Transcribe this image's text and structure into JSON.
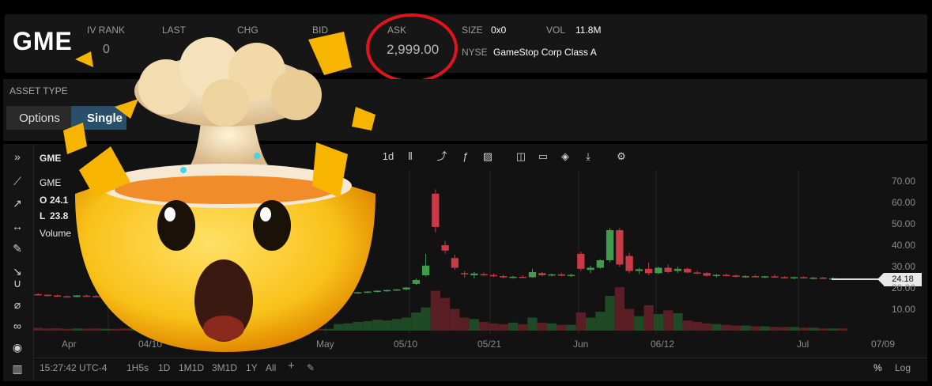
{
  "header": {
    "ticker": "GME",
    "iv_rank_label": "IV RANK",
    "iv_rank_value": "0",
    "last_label": "LAST",
    "chg_label": "CHG",
    "bid_label": "BID",
    "ask_label": "ASK",
    "ask_value": "2,999.00",
    "size_label": "SIZE",
    "size_value": "0x0",
    "vol_label": "VOL",
    "vol_value": "11.8M",
    "exchange": "NYSE",
    "company": "GameStop Corp Class A"
  },
  "asset": {
    "label": "ASSET TYPE",
    "options_label": "Options",
    "single_label": "Single"
  },
  "chart": {
    "symbol_label": "GME",
    "legend_symbol": "GME",
    "open_label": "O",
    "open_value": "24.1",
    "low_label": "L",
    "low_value": "23.8",
    "volume_label": "Volume",
    "interval": "1d",
    "last_price": "24.18",
    "x_labels": [
      "Apr",
      "04/10",
      "May",
      "05/10",
      "05/21",
      "Jun",
      "06/12",
      "Jul",
      "07/09"
    ],
    "y_labels": [
      "70.00",
      "60.00",
      "50.00",
      "40.00",
      "30.00",
      "20.00",
      "10.00"
    ]
  },
  "bottom": {
    "time": "15:27:42 UTC-4",
    "ranges": [
      "1H5s",
      "1D",
      "1M1D",
      "3M1D",
      "1Y",
      "All"
    ],
    "percent": "%",
    "log": "Log"
  },
  "colors": {
    "up": "#3e9c4c",
    "down": "#c93a46",
    "ask_circle": "#e0141c",
    "single_bg": "#2a4f6b"
  },
  "chart_data": {
    "type": "candlestick",
    "x_axis_labels": [
      "Apr",
      "04/10",
      "May",
      "05/10",
      "05/21",
      "Jun",
      "06/12",
      "Jul",
      "07/09"
    ],
    "y_axis_labels": [
      "70.00",
      "60.00",
      "50.00",
      "40.00",
      "30.00",
      "20.00",
      "10.00"
    ],
    "ylim": [
      5,
      75
    ],
    "last": 24.18,
    "candles": [
      {
        "o": 17.2,
        "h": 17.6,
        "l": 16.8,
        "c": 16.9
      },
      {
        "o": 16.9,
        "h": 17.1,
        "l": 16.2,
        "c": 16.5
      },
      {
        "o": 16.6,
        "h": 17.0,
        "l": 16.1,
        "c": 16.3
      },
      {
        "o": 16.2,
        "h": 16.6,
        "l": 15.8,
        "c": 16.0
      },
      {
        "o": 15.9,
        "h": 16.8,
        "l": 15.6,
        "c": 16.6
      },
      {
        "o": 16.5,
        "h": 17.0,
        "l": 16.1,
        "c": 16.4
      },
      {
        "o": 16.3,
        "h": 16.7,
        "l": 15.9,
        "c": 16.1
      },
      {
        "o": 16.1,
        "h": 16.6,
        "l": 15.7,
        "c": 16.4
      },
      {
        "o": 16.4,
        "h": 16.9,
        "l": 16.0,
        "c": 16.2
      },
      {
        "o": 16.2,
        "h": 16.5,
        "l": 15.8,
        "c": 15.9
      },
      {
        "o": 16.0,
        "h": 16.4,
        "l": 15.6,
        "c": 16.2
      },
      {
        "o": 16.2,
        "h": 16.6,
        "l": 15.9,
        "c": 16.0
      },
      {
        "o": 16.0,
        "h": 16.3,
        "l": 15.5,
        "c": 15.7
      },
      {
        "o": 15.8,
        "h": 16.2,
        "l": 15.4,
        "c": 16.0
      },
      {
        "o": 16.0,
        "h": 16.4,
        "l": 15.6,
        "c": 15.8
      },
      {
        "o": 15.8,
        "h": 16.0,
        "l": 15.2,
        "c": 15.4
      },
      {
        "o": 15.4,
        "h": 15.9,
        "l": 15.0,
        "c": 15.7
      },
      {
        "o": 15.7,
        "h": 16.1,
        "l": 15.3,
        "c": 15.5
      },
      {
        "o": 15.5,
        "h": 15.9,
        "l": 15.1,
        "c": 15.8
      },
      {
        "o": 15.8,
        "h": 16.2,
        "l": 15.4,
        "c": 15.6
      },
      {
        "o": 15.6,
        "h": 16.0,
        "l": 15.3,
        "c": 15.9
      },
      {
        "o": 15.9,
        "h": 16.3,
        "l": 15.5,
        "c": 15.7
      },
      {
        "o": 15.7,
        "h": 16.0,
        "l": 15.2,
        "c": 15.4
      },
      {
        "o": 15.4,
        "h": 15.8,
        "l": 15.0,
        "c": 15.6
      },
      {
        "o": 15.6,
        "h": 15.9,
        "l": 15.2,
        "c": 15.3
      },
      {
        "o": 15.3,
        "h": 15.7,
        "l": 14.9,
        "c": 15.5
      },
      {
        "o": 15.5,
        "h": 15.9,
        "l": 15.1,
        "c": 15.2
      },
      {
        "o": 15.2,
        "h": 15.6,
        "l": 14.8,
        "c": 15.4
      },
      {
        "o": 15.4,
        "h": 15.8,
        "l": 15.0,
        "c": 15.6
      },
      {
        "o": 15.6,
        "h": 16.0,
        "l": 15.2,
        "c": 15.3
      },
      {
        "o": 15.3,
        "h": 15.8,
        "l": 15.0,
        "c": 15.7
      },
      {
        "o": 17.0,
        "h": 17.8,
        "l": 16.6,
        "c": 17.5
      },
      {
        "o": 17.4,
        "h": 18.0,
        "l": 17.0,
        "c": 17.8
      },
      {
        "o": 17.8,
        "h": 18.3,
        "l": 17.4,
        "c": 18.1
      },
      {
        "o": 18.1,
        "h": 18.6,
        "l": 17.7,
        "c": 18.4
      },
      {
        "o": 18.4,
        "h": 19.0,
        "l": 18.0,
        "c": 18.8
      },
      {
        "o": 18.8,
        "h": 19.4,
        "l": 18.3,
        "c": 19.1
      },
      {
        "o": 19.1,
        "h": 19.6,
        "l": 18.7,
        "c": 19.4
      },
      {
        "o": 19.4,
        "h": 20.5,
        "l": 19.0,
        "c": 20.3
      },
      {
        "o": 22.0,
        "h": 24.5,
        "l": 21.5,
        "c": 23.8
      },
      {
        "o": 26.0,
        "h": 36.0,
        "l": 25.5,
        "c": 30.5
      },
      {
        "o": 64.0,
        "h": 66.0,
        "l": 46.0,
        "c": 48.5
      },
      {
        "o": 40.0,
        "h": 42.0,
        "l": 36.0,
        "c": 37.5
      },
      {
        "o": 34.0,
        "h": 35.5,
        "l": 28.5,
        "c": 29.5
      },
      {
        "o": 27.0,
        "h": 28.0,
        "l": 25.0,
        "c": 26.5
      },
      {
        "o": 26.0,
        "h": 27.5,
        "l": 24.5,
        "c": 26.8
      },
      {
        "o": 26.5,
        "h": 27.3,
        "l": 25.8,
        "c": 26.1
      },
      {
        "o": 26.1,
        "h": 26.8,
        "l": 25.2,
        "c": 25.6
      },
      {
        "o": 25.6,
        "h": 26.3,
        "l": 24.6,
        "c": 25.0
      },
      {
        "o": 25.0,
        "h": 25.8,
        "l": 24.4,
        "c": 25.3
      },
      {
        "o": 25.3,
        "h": 26.0,
        "l": 24.8,
        "c": 25.1
      },
      {
        "o": 25.1,
        "h": 29.0,
        "l": 24.8,
        "c": 27.5
      },
      {
        "o": 27.0,
        "h": 27.5,
        "l": 25.6,
        "c": 26.0
      },
      {
        "o": 26.0,
        "h": 26.8,
        "l": 25.5,
        "c": 26.4
      },
      {
        "o": 26.4,
        "h": 27.1,
        "l": 25.5,
        "c": 25.8
      },
      {
        "o": 25.8,
        "h": 26.6,
        "l": 25.2,
        "c": 26.2
      },
      {
        "o": 36.0,
        "h": 37.0,
        "l": 28.0,
        "c": 29.0
      },
      {
        "o": 28.5,
        "h": 30.5,
        "l": 27.0,
        "c": 29.5
      },
      {
        "o": 29.5,
        "h": 33.5,
        "l": 29.0,
        "c": 33.0
      },
      {
        "o": 33.0,
        "h": 48.0,
        "l": 32.0,
        "c": 47.0
      },
      {
        "o": 47.0,
        "h": 48.0,
        "l": 30.0,
        "c": 31.0
      },
      {
        "o": 35.0,
        "h": 36.5,
        "l": 27.0,
        "c": 28.0
      },
      {
        "o": 28.0,
        "h": 29.5,
        "l": 26.5,
        "c": 28.8
      },
      {
        "o": 29.0,
        "h": 32.0,
        "l": 26.0,
        "c": 27.0
      },
      {
        "o": 27.0,
        "h": 30.0,
        "l": 26.5,
        "c": 29.5
      },
      {
        "o": 29.5,
        "h": 31.0,
        "l": 27.0,
        "c": 27.5
      },
      {
        "o": 28.0,
        "h": 30.0,
        "l": 27.0,
        "c": 29.0
      },
      {
        "o": 29.0,
        "h": 29.5,
        "l": 27.0,
        "c": 27.3
      },
      {
        "o": 27.3,
        "h": 28.0,
        "l": 26.5,
        "c": 27.0
      },
      {
        "o": 27.0,
        "h": 27.5,
        "l": 25.5,
        "c": 25.8
      },
      {
        "o": 25.8,
        "h": 26.5,
        "l": 25.0,
        "c": 26.2
      },
      {
        "o": 26.2,
        "h": 26.8,
        "l": 25.5,
        "c": 25.9
      },
      {
        "o": 25.9,
        "h": 26.3,
        "l": 25.0,
        "c": 25.3
      },
      {
        "o": 25.3,
        "h": 26.0,
        "l": 24.8,
        "c": 25.6
      },
      {
        "o": 25.6,
        "h": 26.2,
        "l": 25.0,
        "c": 25.2
      },
      {
        "o": 25.2,
        "h": 25.8,
        "l": 24.7,
        "c": 25.5
      },
      {
        "o": 25.5,
        "h": 26.4,
        "l": 25.0,
        "c": 25.1
      },
      {
        "o": 25.1,
        "h": 25.6,
        "l": 24.4,
        "c": 24.8
      },
      {
        "o": 24.8,
        "h": 25.4,
        "l": 24.2,
        "c": 25.1
      },
      {
        "o": 25.1,
        "h": 25.5,
        "l": 24.5,
        "c": 24.7
      },
      {
        "o": 24.7,
        "h": 25.2,
        "l": 24.1,
        "c": 24.9
      },
      {
        "o": 24.9,
        "h": 25.3,
        "l": 24.3,
        "c": 24.5
      },
      {
        "o": 24.5,
        "h": 25.0,
        "l": 24.0,
        "c": 24.6
      },
      {
        "o": 24.4,
        "h": 24.7,
        "l": 24.0,
        "c": 24.18
      }
    ],
    "volume": [
      0.4,
      0.3,
      0.35,
      0.25,
      0.3,
      0.28,
      0.3,
      0.26,
      0.25,
      0.3,
      0.28,
      0.27,
      0.25,
      0.3,
      0.26,
      0.24,
      0.28,
      0.25,
      0.27,
      0.24,
      0.26,
      0.25,
      0.23,
      0.26,
      0.24,
      0.25,
      0.23,
      0.24,
      0.26,
      0.24,
      0.25,
      0.9,
      1.0,
      1.2,
      1.3,
      1.5,
      1.4,
      1.6,
      1.8,
      2.5,
      3.2,
      5.5,
      4.5,
      3.0,
      1.8,
      1.6,
      1.2,
      1.0,
      0.9,
      1.1,
      0.9,
      1.8,
      1.1,
      1.0,
      0.8,
      0.8,
      2.5,
      1.8,
      2.6,
      4.8,
      6.0,
      3.0,
      2.0,
      3.5,
      2.3,
      2.8,
      2.4,
      1.4,
      1.2,
      1.0,
      0.9,
      0.8,
      0.7,
      0.7,
      0.6,
      0.6,
      0.5,
      0.5,
      0.5,
      0.4,
      0.4,
      0.3,
      0.3,
      0.3
    ]
  }
}
